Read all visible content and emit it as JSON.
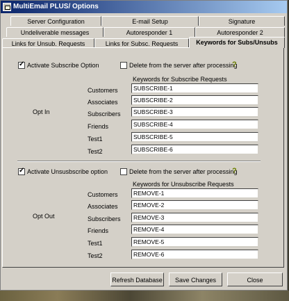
{
  "window": {
    "title": "MultiEmail PLUS/ Options"
  },
  "tabs": {
    "row1": [
      "Server Configuration",
      "E-mail Setup",
      "Signature"
    ],
    "row2": [
      "Undeliverable messages",
      "Autoresponder 1",
      "Autoresponder 2"
    ],
    "row3": [
      "Links for Unsub.  Requests",
      "Links for Subsc.  Requests",
      "Keywords for Subs/Unsubs"
    ]
  },
  "opt_in": {
    "activate_label": "Activate Subscribe Option",
    "activate_checked": true,
    "delete_label": "Delete from the server after processing",
    "delete_checked": false,
    "group_label": "Opt In",
    "keywords_header": "Keywords for Subscribe Requests",
    "rows": [
      {
        "label": "Customers",
        "value": "SUBSCRIBE-1"
      },
      {
        "label": "Associates",
        "value": "SUBSCRIBE-2"
      },
      {
        "label": "Subscribers",
        "value": "SUBSCRIBE-3"
      },
      {
        "label": "Friends",
        "value": "SUBSCRIBE-4"
      },
      {
        "label": "Test1",
        "value": "SUBSCRIBE-5"
      },
      {
        "label": "Test2",
        "value": "SUBSCRIBE-6"
      }
    ]
  },
  "opt_out": {
    "activate_label": "Activate Unsusbscribe option",
    "activate_checked": true,
    "delete_label": "Delete from the server after processing",
    "delete_checked": false,
    "group_label": "Opt Out",
    "keywords_header": "Keywords for Unsubscribe Requests",
    "rows": [
      {
        "label": "Customers",
        "value": "REMOVE-1"
      },
      {
        "label": "Associates",
        "value": "REMOVE-2"
      },
      {
        "label": "Subscribers",
        "value": "REMOVE-3"
      },
      {
        "label": "Friends",
        "value": "REMOVE-4"
      },
      {
        "label": "Test1",
        "value": "REMOVE-5"
      },
      {
        "label": "Test2",
        "value": "REMOVE-6"
      }
    ]
  },
  "help_glyph": "?",
  "buttons": {
    "refresh": "Refresh Database",
    "save": "Save Changes",
    "close": "Close"
  }
}
